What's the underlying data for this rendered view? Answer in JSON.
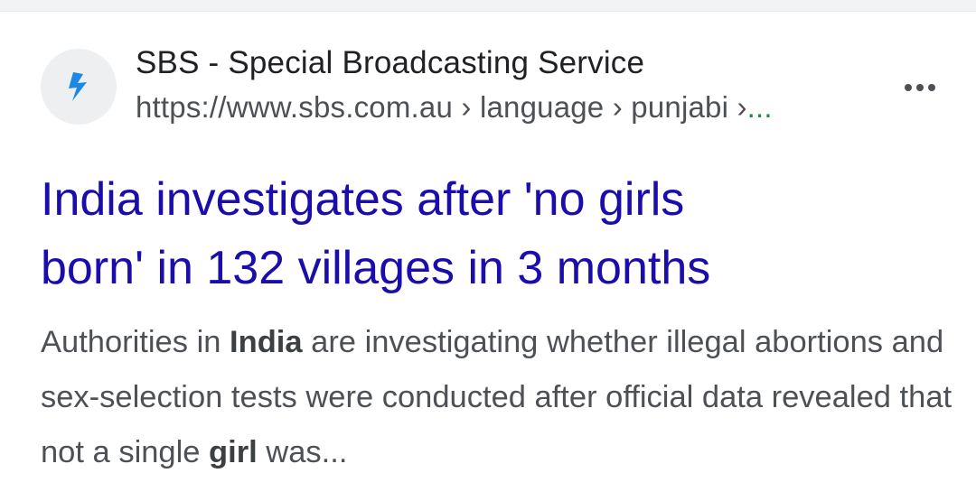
{
  "result": {
    "site_name": "SBS - Special Broadcasting Service",
    "url_text": "https://www.sbs.com.au › language › punjabi ›",
    "url_ellipsis": "...",
    "favicon_icon": "sbs-logo-icon",
    "favicon_color": "#1e88e5",
    "more_icon": "more-vert-icon",
    "title_line1": "India investigates after 'no girls",
    "title_line2": "born' in 132 villages in 3 months",
    "title_color": "#1a0dab",
    "snippet": {
      "part1": "Authorities in ",
      "bold1": "India",
      "part2": " are investigating whether illegal abortions and sex-selection tests were conducted after official data revealed that not a single ",
      "bold2": "girl",
      "part3": " was..."
    }
  }
}
